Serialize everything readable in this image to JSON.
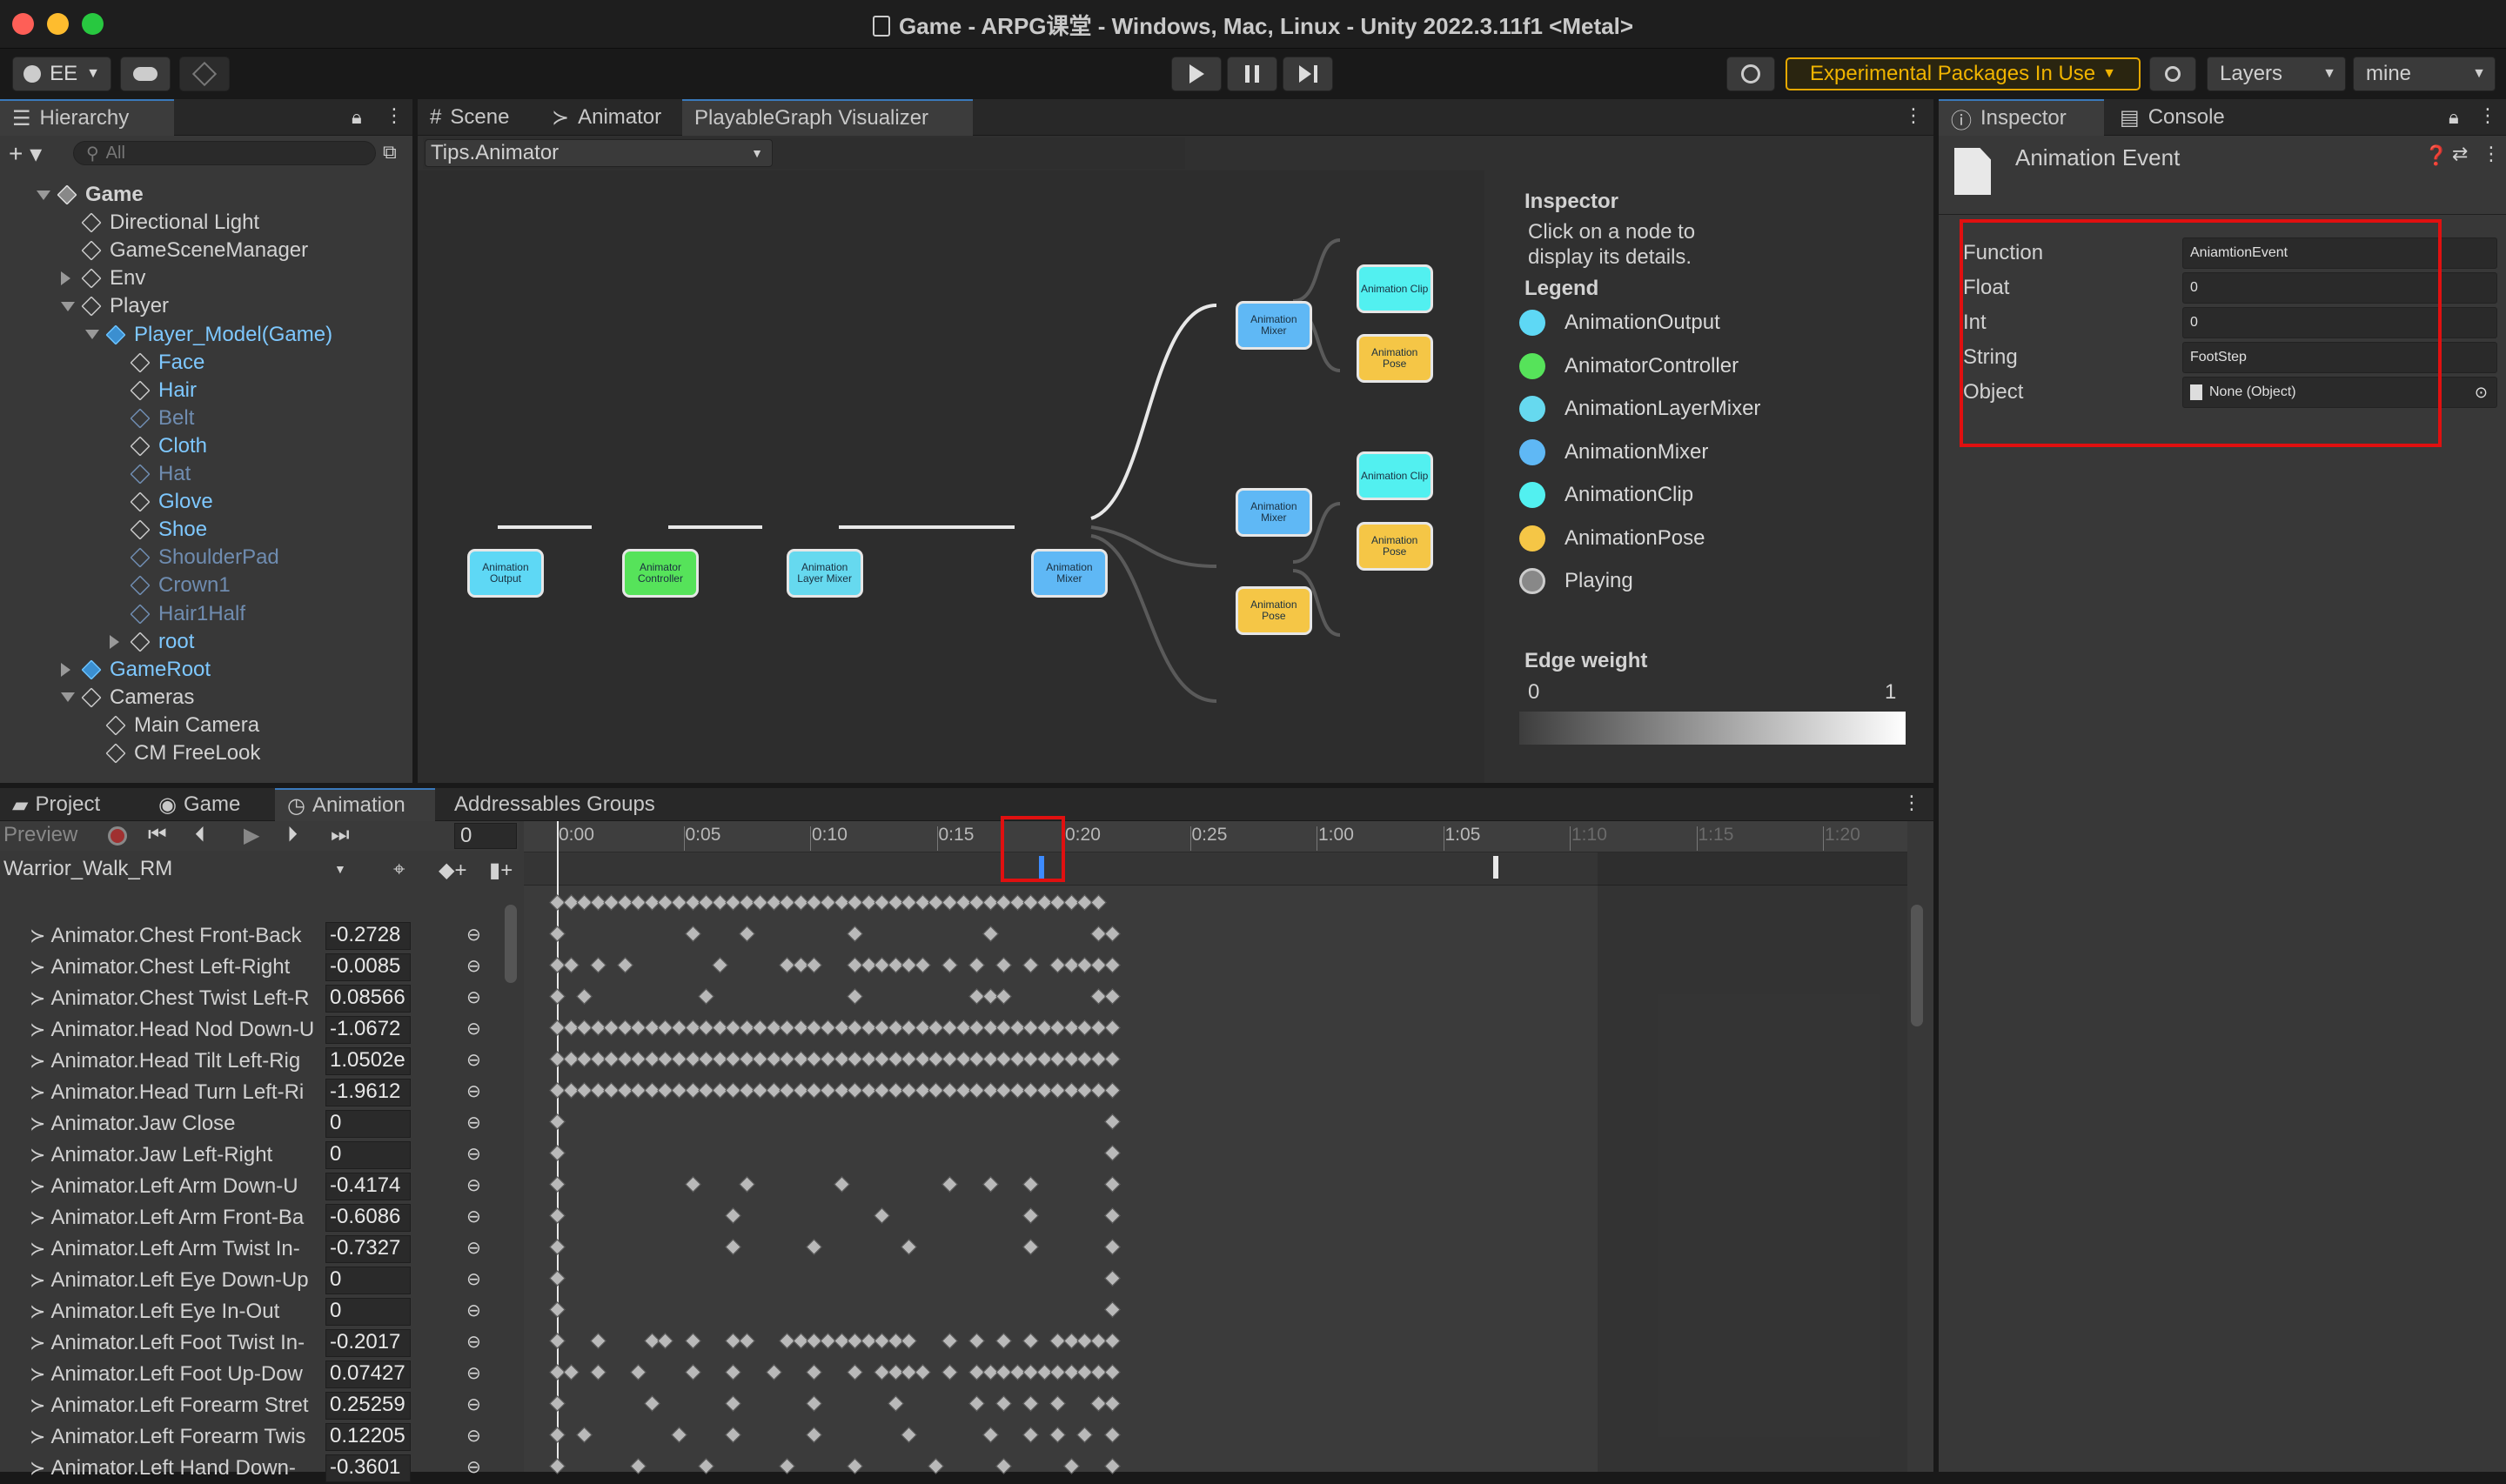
{
  "window": {
    "title": "Game - ARPG课堂 - Windows, Mac, Linux - Unity 2022.3.11f1 <Metal>"
  },
  "toolbar": {
    "account": "EE",
    "experimental": "Experimental Packages In Use",
    "layers": "Layers",
    "layout": "mine"
  },
  "hierarchy": {
    "tab": "Hierarchy",
    "search_placeholder": "All",
    "items": [
      {
        "label": "Game",
        "depth": 0,
        "bold": true,
        "kind": "scene",
        "arrow": "down"
      },
      {
        "label": "Directional Light",
        "depth": 1,
        "kind": "obj"
      },
      {
        "label": "GameSceneManager",
        "depth": 1,
        "kind": "obj"
      },
      {
        "label": "Env",
        "depth": 1,
        "kind": "obj",
        "arrow": "right"
      },
      {
        "label": "Player",
        "depth": 1,
        "kind": "obj",
        "arrow": "down"
      },
      {
        "label": "Player_Model(Game)",
        "depth": 2,
        "kind": "prefab",
        "arrow": "down",
        "blue": true
      },
      {
        "label": "Face",
        "depth": 3,
        "kind": "obj",
        "blue": true
      },
      {
        "label": "Hair",
        "depth": 3,
        "kind": "obj",
        "blue": true
      },
      {
        "label": "Belt",
        "depth": 3,
        "kind": "obj",
        "dim": true
      },
      {
        "label": "Cloth",
        "depth": 3,
        "kind": "obj",
        "blue": true
      },
      {
        "label": "Hat",
        "depth": 3,
        "kind": "obj",
        "dim": true
      },
      {
        "label": "Glove",
        "depth": 3,
        "kind": "obj",
        "blue": true
      },
      {
        "label": "Shoe",
        "depth": 3,
        "kind": "obj",
        "blue": true
      },
      {
        "label": "ShoulderPad",
        "depth": 3,
        "kind": "obj",
        "dim": true
      },
      {
        "label": "Crown1",
        "depth": 3,
        "kind": "obj",
        "dim": true
      },
      {
        "label": "Hair1Half",
        "depth": 3,
        "kind": "obj",
        "dim": true
      },
      {
        "label": "root",
        "depth": 3,
        "kind": "obj",
        "arrow": "right",
        "blue": true
      },
      {
        "label": "GameRoot",
        "depth": 1,
        "kind": "prefab",
        "arrow": "right",
        "blue": true
      },
      {
        "label": "Cameras",
        "depth": 1,
        "kind": "obj",
        "arrow": "down"
      },
      {
        "label": "Main Camera",
        "depth": 2,
        "kind": "obj"
      },
      {
        "label": "CM FreeLook",
        "depth": 2,
        "kind": "obj"
      }
    ]
  },
  "center_tabs": [
    "Scene",
    "Animator",
    "PlayableGraph Visualizer"
  ],
  "graph": {
    "selector": "Tips.Animator",
    "nodes": [
      {
        "label": "Animation Output",
        "color": "#5ed8f5"
      },
      {
        "label": "Animator Controller",
        "color": "#56e35a"
      },
      {
        "label": "Animation Layer Mixer",
        "color": "#66d9ef"
      },
      {
        "label": "Animation Mixer",
        "color": "#5fb8f5"
      },
      {
        "label": "Animation Mixer",
        "color": "#5fb8f5"
      },
      {
        "label": "Animation Mixer",
        "color": "#5fb8f5"
      },
      {
        "label": "Animation Clip",
        "color": "#52f0f0"
      },
      {
        "label": "Animation Pose",
        "color": "#f5c646"
      },
      {
        "label": "Animation Clip",
        "color": "#52f0f0"
      },
      {
        "label": "Animation Pose",
        "color": "#f5c646"
      },
      {
        "label": "Animation Pose",
        "color": "#f5c646"
      }
    ],
    "inspector_title": "Inspector",
    "inspector_hint": "Click on a node to display its details.",
    "legend_title": "Legend",
    "legend": [
      {
        "label": "AnimationOutput",
        "color": "#5ed8f5"
      },
      {
        "label": "AnimatorController",
        "color": "#56e35a"
      },
      {
        "label": "AnimationLayerMixer",
        "color": "#66d9ef"
      },
      {
        "label": "AnimationMixer",
        "color": "#5fb8f5"
      },
      {
        "label": "AnimationClip",
        "color": "#52f0f0"
      },
      {
        "label": "AnimationPose",
        "color": "#f5c646"
      },
      {
        "label": "Playing",
        "color": "#888888"
      }
    ],
    "edge_weight_title": "Edge weight",
    "edge_min": "0",
    "edge_max": "1"
  },
  "inspector": {
    "tabs": [
      "Inspector",
      "Console"
    ],
    "title": "Animation Event",
    "fields": [
      {
        "label": "Function",
        "value": "AniamtionEvent"
      },
      {
        "label": "Float",
        "value": "0"
      },
      {
        "label": "Int",
        "value": "0"
      },
      {
        "label": "String",
        "value": "FootStep"
      },
      {
        "label": "Object",
        "value": "None (Object)"
      }
    ]
  },
  "bottom_tabs": [
    "Project",
    "Game",
    "Animation",
    "Addressables Groups"
  ],
  "animation": {
    "preview": "Preview",
    "frame": "0",
    "clip": "Warrior_Walk_RM",
    "ticks": [
      "0:00",
      "0:05",
      "0:10",
      "0:15",
      "0:20",
      "0:25",
      "1:00",
      "1:05",
      "1:10",
      "1:15",
      "1:20"
    ],
    "properties": [
      {
        "name": "Animator.Chest Front-Back",
        "value": "-0.2728"
      },
      {
        "name": "Animator.Chest Left-Right",
        "value": "-0.0085"
      },
      {
        "name": "Animator.Chest Twist Left-R",
        "value": "0.08566"
      },
      {
        "name": "Animator.Head Nod Down-U",
        "value": "-1.0672"
      },
      {
        "name": "Animator.Head Tilt Left-Rig",
        "value": "1.0502e"
      },
      {
        "name": "Animator.Head Turn Left-Ri",
        "value": "-1.9612"
      },
      {
        "name": "Animator.Jaw Close",
        "value": "0"
      },
      {
        "name": "Animator.Jaw Left-Right",
        "value": "0"
      },
      {
        "name": "Animator.Left Arm Down-U",
        "value": "-0.4174"
      },
      {
        "name": "Animator.Left Arm Front-Ba",
        "value": "-0.6086"
      },
      {
        "name": "Animator.Left Arm Twist In-",
        "value": "-0.7327"
      },
      {
        "name": "Animator.Left Eye Down-Up",
        "value": "0"
      },
      {
        "name": "Animator.Left Eye In-Out",
        "value": "0"
      },
      {
        "name": "Animator.Left Foot Twist In-",
        "value": "-0.2017"
      },
      {
        "name": "Animator.Left Foot Up-Dow",
        "value": "0.07427"
      },
      {
        "name": "Animator.Left Forearm Stret",
        "value": "0.25259"
      },
      {
        "name": "Animator.Left Forearm Twis",
        "value": "0.12205"
      },
      {
        "name": "Animator.Left Hand Down-",
        "value": "-0.3601"
      }
    ]
  }
}
